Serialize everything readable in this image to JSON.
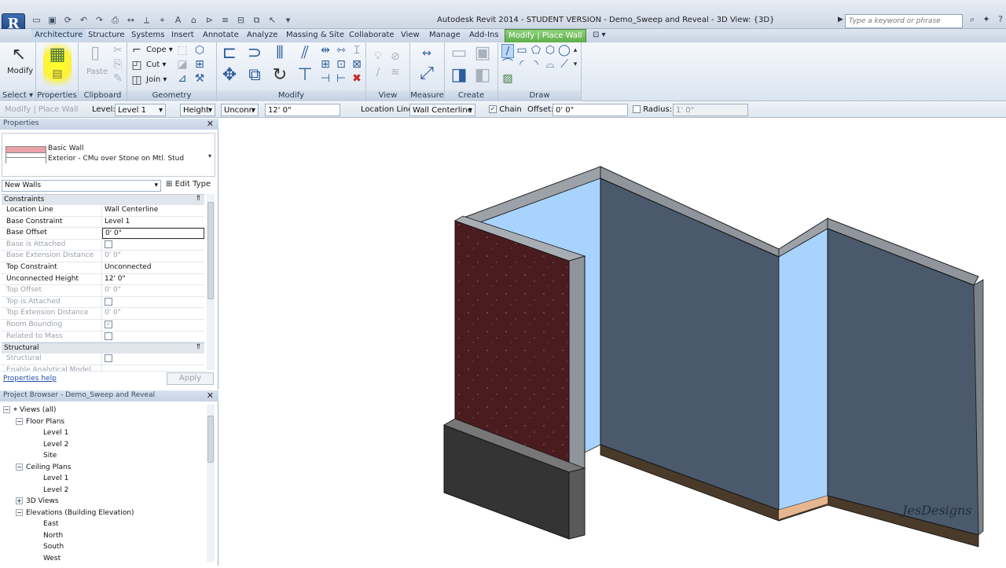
{
  "app": {
    "title": "Autodesk Revit 2014 - STUDENT VERSION -    Demo_Sweep and Reveal - 3D View: {3D}",
    "app_button": "R",
    "search_placeholder": "Type a keyword or phrase"
  },
  "tabs": [
    "Architecture",
    "Structure",
    "Systems",
    "Insert",
    "Annotate",
    "Analyze",
    "Massing & Site",
    "Collaborate",
    "View",
    "Manage",
    "Add-Ins",
    "Modify | Place Wall"
  ],
  "ribbon": {
    "panels": [
      "Select",
      "Properties",
      "Clipboard",
      "Geometry",
      "Modify",
      "View",
      "Measure",
      "Create",
      "Draw"
    ],
    "modify_label": "Modify",
    "paste_label": "Paste",
    "cope_label": "Cope",
    "cut_label": "Cut",
    "join_label": "Join"
  },
  "options_bar": {
    "context": "Modify | Place Wall",
    "level_label": "Level:",
    "level_value": "Level 1",
    "height_value": "Height",
    "top_value": "Unconn",
    "height_dim": "12'  0\"",
    "location_line_label": "Location Line:",
    "location_line_value": "Wall Centerline",
    "chain_label": "Chain",
    "chain_checked": true,
    "offset_label": "Offset:",
    "offset_value": "0'  0\"",
    "radius_label": "Radius:",
    "radius_value": "1'  0\""
  },
  "properties": {
    "header": "Properties",
    "family": "Basic Wall",
    "type": "Exterior - CMu over Stone on Mtl. Stud",
    "instance_filter": "New Walls",
    "edit_type_label": "Edit Type",
    "categories": {
      "constraints": "Constraints",
      "structural": "Structural"
    },
    "rows": [
      {
        "k": "Location Line",
        "v": "Wall Centerline",
        "disabled": false
      },
      {
        "k": "Base Constraint",
        "v": "Level 1",
        "disabled": false
      },
      {
        "k": "Base Offset",
        "v": "0'  0\"",
        "disabled": false
      },
      {
        "k": "Base is Attached",
        "v": "",
        "disabled": true
      },
      {
        "k": "Base Extension Distance",
        "v": "0'  0\"",
        "disabled": true
      },
      {
        "k": "Top Constraint",
        "v": "Unconnected",
        "disabled": false
      },
      {
        "k": "Unconnected Height",
        "v": "12'  0\"",
        "disabled": false
      },
      {
        "k": "Top Offset",
        "v": "0'  0\"",
        "disabled": true
      },
      {
        "k": "Top is Attached",
        "v": "",
        "disabled": true
      },
      {
        "k": "Top Extension Distance",
        "v": "0'  0\"",
        "disabled": true
      },
      {
        "k": "Room Bounding",
        "v": "",
        "disabled": true
      },
      {
        "k": "Related to Mass",
        "v": "",
        "disabled": true
      }
    ],
    "structural_rows": [
      {
        "k": "Structural",
        "v": "",
        "disabled": true
      },
      {
        "k": "Enable Analytical Model",
        "v": "",
        "disabled": true
      }
    ],
    "help_link": "Properties help",
    "apply_label": "Apply"
  },
  "project_browser": {
    "header": "Project Browser - Demo_Sweep and Reveal",
    "nodes": [
      {
        "label": "Views (all)"
      },
      {
        "label": "Floor Plans"
      },
      {
        "label": "Level 1"
      },
      {
        "label": "Level 2"
      },
      {
        "label": "Site"
      },
      {
        "label": "Ceiling Plans"
      },
      {
        "label": "Level 1"
      },
      {
        "label": "Level 2"
      },
      {
        "label": "3D Views"
      },
      {
        "label": "Elevations (Building Elevation)"
      },
      {
        "label": "East"
      },
      {
        "label": "North"
      },
      {
        "label": "South"
      },
      {
        "label": "West"
      }
    ]
  },
  "watermark": "JesDesigns",
  "colors": {
    "context_tab": "#6bbf56",
    "highlight": "#fdf13a",
    "wall_face": "#4a5a6c",
    "wall_glass": "#a9d3ff",
    "masonry": "#4a1c20"
  }
}
